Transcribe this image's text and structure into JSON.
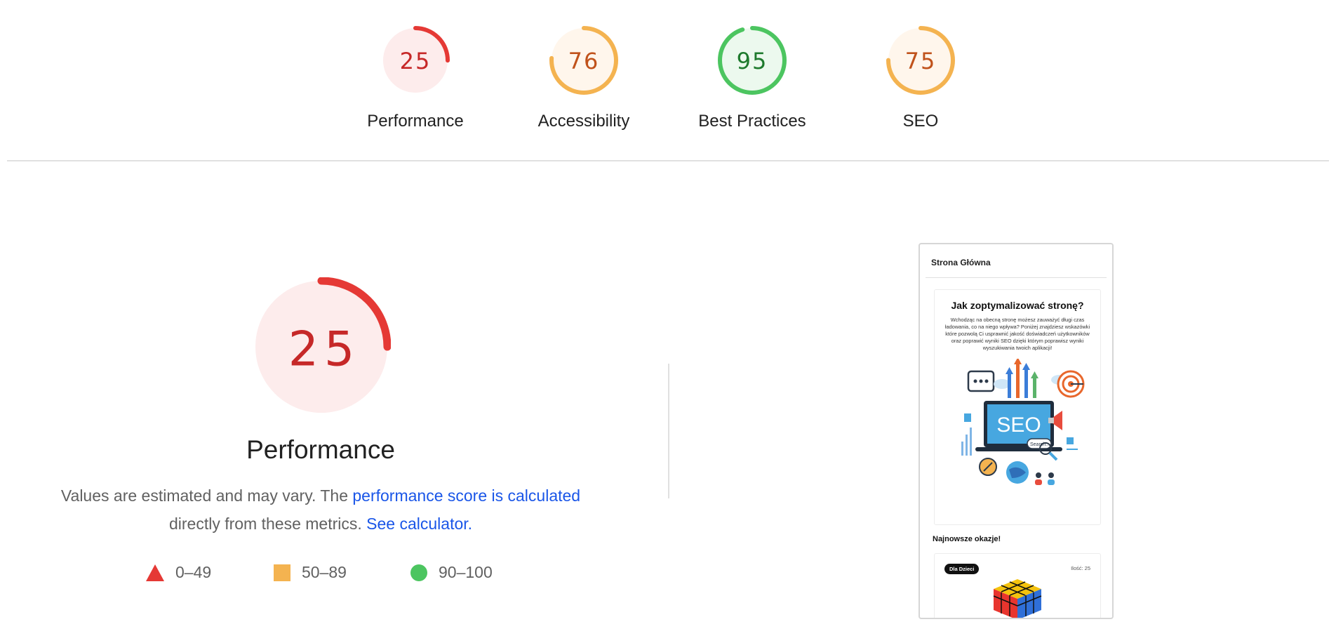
{
  "colors": {
    "fail": "#e53935",
    "fail_text": "#c62828",
    "fail_bg": "#fdecec",
    "average": "#f4b350",
    "average_text": "#c0521b",
    "average_bg": "#fff6ec",
    "pass": "#4cc560",
    "pass_text": "#1e7a2d",
    "pass_bg": "#ecf9ee"
  },
  "gauges": [
    {
      "score": "25",
      "value": 25,
      "label": "Performance",
      "rating": "fail"
    },
    {
      "score": "76",
      "value": 76,
      "label": "Accessibility",
      "rating": "average"
    },
    {
      "score": "95",
      "value": 95,
      "label": "Best Practices",
      "rating": "pass"
    },
    {
      "score": "75",
      "value": 75,
      "label": "SEO",
      "rating": "average"
    }
  ],
  "performance": {
    "score": "25",
    "value": 25,
    "title": "Performance",
    "desc_text1": "Values are estimated and may vary. The ",
    "desc_link1": "performance score is calculated",
    "desc_text2": "directly from these metrics.",
    "desc_link2": "See calculator."
  },
  "legend": [
    {
      "shape": "triangle",
      "range": "0–49"
    },
    {
      "shape": "square",
      "range": "50–89"
    },
    {
      "shape": "circle",
      "range": "90–100"
    }
  ],
  "thumbnail": {
    "header": "Strona Główna",
    "card_title": "Jak zoptymalizować stronę?",
    "card_text": "Wchodząc na obecną stronę możesz zauważyć długi czas ładowania, co na niego wpływa? Poniżej znajdziesz wskazówki które pozwolą Ci usprawnić jakość doświadczeń użytkowników oraz poprawić wyniki SEO dzięki którym poprawisz wyniki wyszukiwania twoich aplikacji!",
    "illustration_text": "SEO",
    "search_text": "Search...",
    "subheading": "Najnowsze okazje!",
    "tag": "Dla Dzieci",
    "quantity": "Ilość: 25"
  }
}
